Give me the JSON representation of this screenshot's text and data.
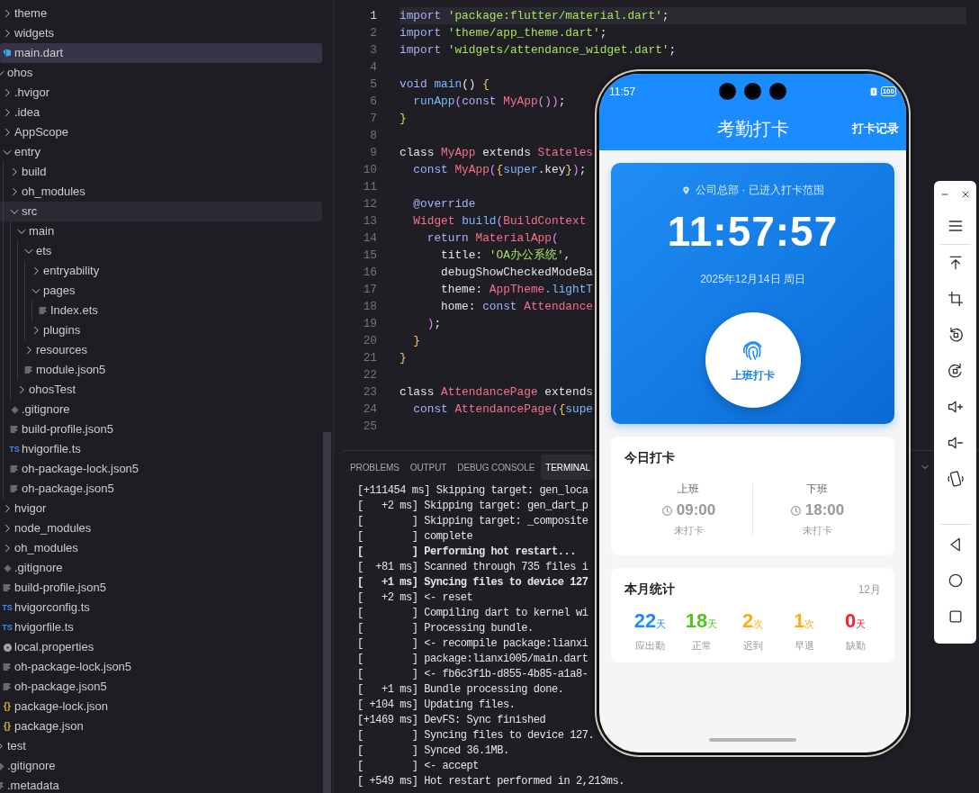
{
  "explorer": {
    "tree": [
      {
        "children": [
          {
            "name": "theme",
            "kind": "folder",
            "expanded": false,
            "selected": false,
            "hovered": false
          },
          {
            "name": "widgets",
            "kind": "folder",
            "expanded": false,
            "selected": false,
            "hovered": false
          },
          {
            "name": "main.dart",
            "kind": "dart-file",
            "selected": true,
            "hovered": false
          }
        ]
      },
      {
        "name": "ohos",
        "kind": "folder",
        "expanded": true,
        "selected": false,
        "hovered": false,
        "children": [
          {
            "name": ".hvigor",
            "kind": "folder",
            "expanded": false,
            "selected": false,
            "hovered": false
          },
          {
            "name": ".idea",
            "kind": "folder",
            "expanded": false,
            "selected": false,
            "hovered": false
          },
          {
            "name": "AppScope",
            "kind": "folder",
            "expanded": false,
            "selected": false,
            "hovered": false
          },
          {
            "name": "entry",
            "kind": "folder",
            "expanded": true,
            "selected": false,
            "hovered": false,
            "children": [
              {
                "name": "build",
                "kind": "folder",
                "expanded": false,
                "selected": false,
                "hovered": false
              },
              {
                "name": "oh_modules",
                "kind": "folder",
                "expanded": false,
                "selected": false,
                "hovered": false
              },
              {
                "name": "src",
                "kind": "folder",
                "expanded": true,
                "selected": false,
                "hovered": true,
                "children": [
                  {
                    "name": "main",
                    "kind": "folder",
                    "expanded": true,
                    "selected": false,
                    "hovered": false,
                    "children": [
                      {
                        "name": "ets",
                        "kind": "folder",
                        "expanded": true,
                        "selected": false,
                        "hovered": false,
                        "children": [
                          {
                            "name": "entryability",
                            "kind": "folder",
                            "expanded": false,
                            "selected": false,
                            "hovered": false
                          },
                          {
                            "name": "pages",
                            "kind": "folder",
                            "expanded": true,
                            "selected": false,
                            "hovered": false,
                            "children": [
                              {
                                "name": "Index.ets",
                                "kind": "text-file",
                                "selected": false,
                                "hovered": false
                              }
                            ]
                          },
                          {
                            "name": "plugins",
                            "kind": "folder",
                            "expanded": false,
                            "selected": false,
                            "hovered": false
                          }
                        ]
                      },
                      {
                        "name": "resources",
                        "kind": "folder",
                        "expanded": false,
                        "selected": false,
                        "hovered": false
                      },
                      {
                        "name": "module.json5",
                        "kind": "text-file",
                        "selected": false,
                        "hovered": false
                      }
                    ]
                  },
                  {
                    "name": "ohosTest",
                    "kind": "folder",
                    "expanded": false,
                    "selected": false,
                    "hovered": false
                  }
                ]
              },
              {
                "name": ".gitignore",
                "kind": "git-file",
                "selected": false,
                "hovered": false
              },
              {
                "name": "build-profile.json5",
                "kind": "text-file",
                "selected": false,
                "hovered": false
              },
              {
                "name": "hvigorfile.ts",
                "kind": "ts-file",
                "icon_label": "TS",
                "selected": false,
                "hovered": false
              },
              {
                "name": "oh-package-lock.json5",
                "kind": "text-file",
                "selected": false,
                "hovered": false
              },
              {
                "name": "oh-package.json5",
                "kind": "text-file",
                "selected": false,
                "hovered": false
              }
            ]
          },
          {
            "name": "hvigor",
            "kind": "folder",
            "expanded": false,
            "selected": false,
            "hovered": false
          },
          {
            "name": "node_modules",
            "kind": "folder",
            "expanded": false,
            "selected": false,
            "hovered": false
          },
          {
            "name": "oh_modules",
            "kind": "folder",
            "expanded": false,
            "selected": false,
            "hovered": false
          },
          {
            "name": ".gitignore",
            "kind": "git-file",
            "selected": false,
            "hovered": false
          },
          {
            "name": "build-profile.json5",
            "kind": "text-file",
            "selected": false,
            "hovered": false
          },
          {
            "name": "hvigorconfig.ts",
            "kind": "ts-file",
            "icon_label": "TS",
            "selected": false,
            "hovered": false
          },
          {
            "name": "hvigorfile.ts",
            "kind": "ts-file",
            "icon_label": "TS",
            "selected": false,
            "hovered": false
          },
          {
            "name": "local.properties",
            "kind": "config-file",
            "selected": false,
            "hovered": false
          },
          {
            "name": "oh-package-lock.json5",
            "kind": "text-file",
            "selected": false,
            "hovered": false
          },
          {
            "name": "oh-package.json5",
            "kind": "text-file",
            "selected": false,
            "hovered": false
          },
          {
            "name": "package-lock.json",
            "kind": "json-file",
            "icon_label": "{}",
            "selected": false,
            "hovered": false
          },
          {
            "name": "package.json",
            "kind": "json-file",
            "icon_label": "{}",
            "selected": false,
            "hovered": false
          }
        ]
      },
      {
        "name": "test",
        "kind": "folder",
        "expanded": false,
        "selected": false,
        "hovered": false
      },
      {
        "name": ".gitignore",
        "kind": "git-file",
        "selected": false,
        "hovered": false
      },
      {
        "name": ".metadata",
        "kind": "text-file",
        "selected": false,
        "hovered": false
      }
    ]
  },
  "editor": {
    "lines": [
      {
        "number": "1",
        "current": true,
        "tokens": [
          {
            "kind": "kw",
            "text": "import "
          },
          {
            "kind": "str",
            "text": "'package:flutter/material.dart'"
          },
          {
            "kind": "plain",
            "text": ";"
          }
        ]
      },
      {
        "number": "2",
        "current": false,
        "tokens": [
          {
            "kind": "kw",
            "text": "import "
          },
          {
            "kind": "str",
            "text": "'theme/app_theme.dart'"
          },
          {
            "kind": "plain",
            "text": ";"
          }
        ]
      },
      {
        "number": "3",
        "current": false,
        "tokens": [
          {
            "kind": "kw",
            "text": "import "
          },
          {
            "kind": "str",
            "text": "'widgets/attendance_widget.dart'"
          },
          {
            "kind": "plain",
            "text": ";"
          }
        ]
      },
      {
        "number": "4",
        "current": false
      },
      {
        "number": "5",
        "current": false,
        "tokens": [
          {
            "kind": "kw",
            "text": "void "
          },
          {
            "kind": "fn",
            "text": "main"
          },
          {
            "kind": "plain",
            "text": "() "
          },
          {
            "kind": "brace",
            "text": "{"
          }
        ]
      },
      {
        "number": "6",
        "current": false,
        "tokens": [
          {
            "kind": "fn",
            "text": "  runApp"
          },
          {
            "kind": "paren",
            "text": "("
          },
          {
            "kind": "kw",
            "text": "const "
          },
          {
            "kind": "type",
            "text": "MyApp"
          },
          {
            "kind": "paren",
            "text": "())"
          },
          {
            "kind": "plain",
            "text": ";"
          }
        ]
      },
      {
        "number": "7",
        "current": false,
        "tokens": [
          {
            "kind": "brace",
            "text": "}"
          }
        ]
      },
      {
        "number": "8",
        "current": false
      },
      {
        "number": "9",
        "current": false,
        "tokens": [
          {
            "kind": "plain",
            "text": "class "
          },
          {
            "kind": "type",
            "text": "MyApp"
          },
          {
            "kind": "plain",
            "text": " extends "
          },
          {
            "kind": "type",
            "text": "Stateles"
          }
        ]
      },
      {
        "number": "10",
        "current": false,
        "tokens": [
          {
            "kind": "kw",
            "text": "  const "
          },
          {
            "kind": "type",
            "text": "MyApp"
          },
          {
            "kind": "paren",
            "text": "("
          },
          {
            "kind": "brace",
            "text": "{"
          },
          {
            "kind": "fn",
            "text": "super"
          },
          {
            "kind": "plain",
            "text": ".key"
          },
          {
            "kind": "brace",
            "text": "}"
          },
          {
            "kind": "paren",
            "text": ")"
          },
          {
            "kind": "plain",
            "text": ";"
          }
        ]
      },
      {
        "number": "11",
        "current": false
      },
      {
        "number": "12",
        "current": false,
        "tokens": [
          {
            "kind": "kw",
            "text": "  @override"
          }
        ]
      },
      {
        "number": "13",
        "current": false,
        "tokens": [
          {
            "kind": "type",
            "text": "  Widget "
          },
          {
            "kind": "fn",
            "text": "build"
          },
          {
            "kind": "paren",
            "text": "("
          },
          {
            "kind": "type",
            "text": "BuildContext"
          }
        ]
      },
      {
        "number": "14",
        "current": false,
        "tokens": [
          {
            "kind": "kw",
            "text": "    return "
          },
          {
            "kind": "type",
            "text": "MaterialApp"
          },
          {
            "kind": "paren",
            "text": "("
          }
        ]
      },
      {
        "number": "15",
        "current": false,
        "tokens": [
          {
            "kind": "plain",
            "text": "      title: "
          },
          {
            "kind": "str",
            "text": "'OA办公系统'"
          },
          {
            "kind": "plain",
            "text": ","
          }
        ]
      },
      {
        "number": "16",
        "current": false,
        "tokens": [
          {
            "kind": "plain",
            "text": "      debugShowCheckedModeBa"
          }
        ]
      },
      {
        "number": "17",
        "current": false,
        "tokens": [
          {
            "kind": "plain",
            "text": "      theme: "
          },
          {
            "kind": "type",
            "text": "AppTheme"
          },
          {
            "kind": "fn",
            "text": ".lightT"
          }
        ]
      },
      {
        "number": "18",
        "current": false,
        "tokens": [
          {
            "kind": "plain",
            "text": "      home: "
          },
          {
            "kind": "kw",
            "text": "const "
          },
          {
            "kind": "type",
            "text": "Attendance"
          }
        ]
      },
      {
        "number": "19",
        "current": false,
        "tokens": [
          {
            "kind": "paren",
            "text": "    )"
          },
          {
            "kind": "plain",
            "text": ";"
          }
        ]
      },
      {
        "number": "20",
        "current": false,
        "tokens": [
          {
            "kind": "brace",
            "text": "  }"
          }
        ]
      },
      {
        "number": "21",
        "current": false,
        "tokens": [
          {
            "kind": "brace",
            "text": "}"
          }
        ]
      },
      {
        "number": "22",
        "current": false
      },
      {
        "number": "23",
        "current": false,
        "tokens": [
          {
            "kind": "plain",
            "text": "class "
          },
          {
            "kind": "type",
            "text": "AttendancePage"
          },
          {
            "kind": "plain",
            "text": " extends"
          }
        ]
      },
      {
        "number": "24",
        "current": false,
        "tokens": [
          {
            "kind": "kw",
            "text": "  const "
          },
          {
            "kind": "type",
            "text": "AttendancePage"
          },
          {
            "kind": "paren",
            "text": "("
          },
          {
            "kind": "brace",
            "text": "{"
          },
          {
            "kind": "fn",
            "text": "supe"
          }
        ]
      },
      {
        "number": "25",
        "current": false
      }
    ]
  },
  "panel": {
    "tabs": [
      {
        "label": "PROBLEMS",
        "selected": false
      },
      {
        "label": "OUTPUT",
        "selected": false
      },
      {
        "label": "DEBUG CONSOLE",
        "selected": false
      },
      {
        "label": "TERMINAL",
        "selected": true
      }
    ],
    "terminal_lines": [
      {
        "text": "[+111454 ms] Skipping target: gen_loca",
        "bold": false
      },
      {
        "text": "[   +2 ms] Skipping target: gen_dart_p",
        "bold": false
      },
      {
        "text": "[        ] Skipping target: _composite",
        "bold": false
      },
      {
        "text": "[        ] complete",
        "bold": false
      },
      {
        "text": "[        ] Performing hot restart...",
        "bold": true
      },
      {
        "text": "[  +81 ms] Scanned through 735 files i",
        "bold": false
      },
      {
        "text": "[   +1 ms] Syncing files to device 127",
        "bold": true
      },
      {
        "text": "[   +2 ms] <- reset",
        "bold": false
      },
      {
        "text": "[        ] Compiling dart to kernel wi",
        "bold": false
      },
      {
        "text": "[        ] Processing bundle.",
        "bold": false
      },
      {
        "text": "[        ] <- recompile package:lianxi",
        "bold": false
      },
      {
        "text": "[        ] package:lianxi005/main.dart",
        "bold": false
      },
      {
        "text": "[        ] <- fb6c3f1b-d855-4b85-a1a8-",
        "bold": false
      },
      {
        "text": "[   +1 ms] Bundle processing done.",
        "bold": false
      },
      {
        "text": "[ +104 ms] Updating files.",
        "bold": false
      },
      {
        "text": "[+1469 ms] DevFS: Sync finished",
        "bold": false
      },
      {
        "text": "[        ] Syncing files to device 127.",
        "bold": false
      },
      {
        "text": "[        ] Synced 36.1MB.",
        "bold": false
      },
      {
        "text": "[        ] <- accept",
        "bold": false
      },
      {
        "text": "[ +549 ms] Hot restart performed in 2,213ms.",
        "bold": false
      }
    ]
  },
  "phone": {
    "status_time": "11:57",
    "battery": "100",
    "title": "考勤打卡",
    "action": "打卡记录",
    "punch_card": {
      "location": "公司总部 · 已进入打卡范围",
      "time": "11:57:57",
      "date": "2025年12月14日 周日",
      "button": "上班打卡"
    },
    "today": {
      "title": "今日打卡",
      "slots": [
        {
          "label": "上班",
          "time": "09:00",
          "status": "未打卡"
        },
        {
          "label": "下班",
          "time": "18:00",
          "status": "未打卡"
        }
      ]
    },
    "month": {
      "title": "本月统计",
      "month": "12月",
      "stats": [
        {
          "value": "22",
          "unit": "天",
          "label": "应出勤",
          "color": "#1a8cff"
        },
        {
          "value": "18",
          "unit": "天",
          "label": "正常",
          "color": "#52c41a"
        },
        {
          "value": "2",
          "unit": "次",
          "label": "迟到",
          "color": "#faad14"
        },
        {
          "value": "1",
          "unit": "次",
          "label": "早退",
          "color": "#faad14"
        },
        {
          "value": "0",
          "unit": "天",
          "label": "缺勤",
          "color": "#f5222d"
        }
      ]
    }
  },
  "emulator_toolbar": {
    "window_controls": [
      {
        "kind": "minimize"
      },
      {
        "kind": "close"
      }
    ],
    "tools": [
      {
        "kind": "menu"
      },
      {
        "kind": "pin-top"
      },
      {
        "kind": "crop"
      },
      {
        "kind": "rotate-left"
      },
      {
        "kind": "rotate-right"
      },
      {
        "kind": "volume-up"
      },
      {
        "kind": "volume-down"
      },
      {
        "kind": "shake"
      }
    ],
    "nav_buttons": [
      {
        "kind": "back"
      },
      {
        "kind": "home"
      },
      {
        "kind": "recents"
      }
    ]
  }
}
